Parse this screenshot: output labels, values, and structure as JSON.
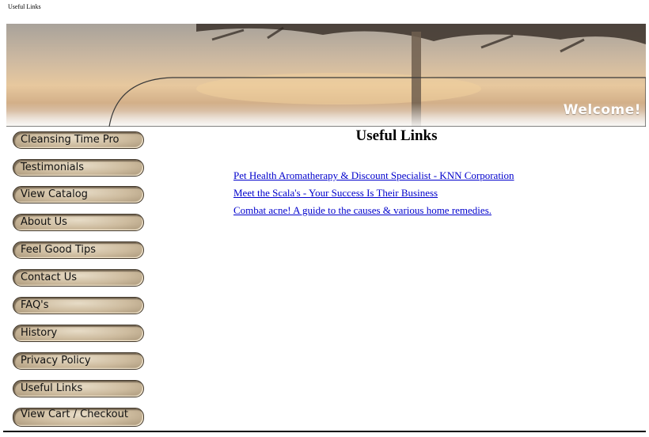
{
  "page": {
    "tab_title": "Useful Links"
  },
  "banner": {
    "welcome_text": "Welcome!"
  },
  "sidebar": {
    "items": [
      {
        "label": "Cleansing Time Pro"
      },
      {
        "label": "Testimonials"
      },
      {
        "label": "View Catalog"
      },
      {
        "label": "About Us"
      },
      {
        "label": "Feel Good Tips"
      },
      {
        "label": "Contact Us"
      },
      {
        "label": "FAQ's"
      },
      {
        "label": "History"
      },
      {
        "label": "Privacy Policy"
      },
      {
        "label": "Useful Links"
      },
      {
        "label": "View Cart / Checkout"
      }
    ]
  },
  "main": {
    "heading": "Useful Links",
    "links": [
      {
        "text": "Pet Health Aromatherapy & Discount Specialist - KNN Corporation"
      },
      {
        "text": "Meet the Scala's - Your Success Is Their Business"
      },
      {
        "text": "Combat acne! A guide to the causes & various home remedies."
      }
    ]
  },
  "colors": {
    "link": "#0000cc",
    "button": "#cdbb9e",
    "banner_sky": "#d9c2a3"
  }
}
